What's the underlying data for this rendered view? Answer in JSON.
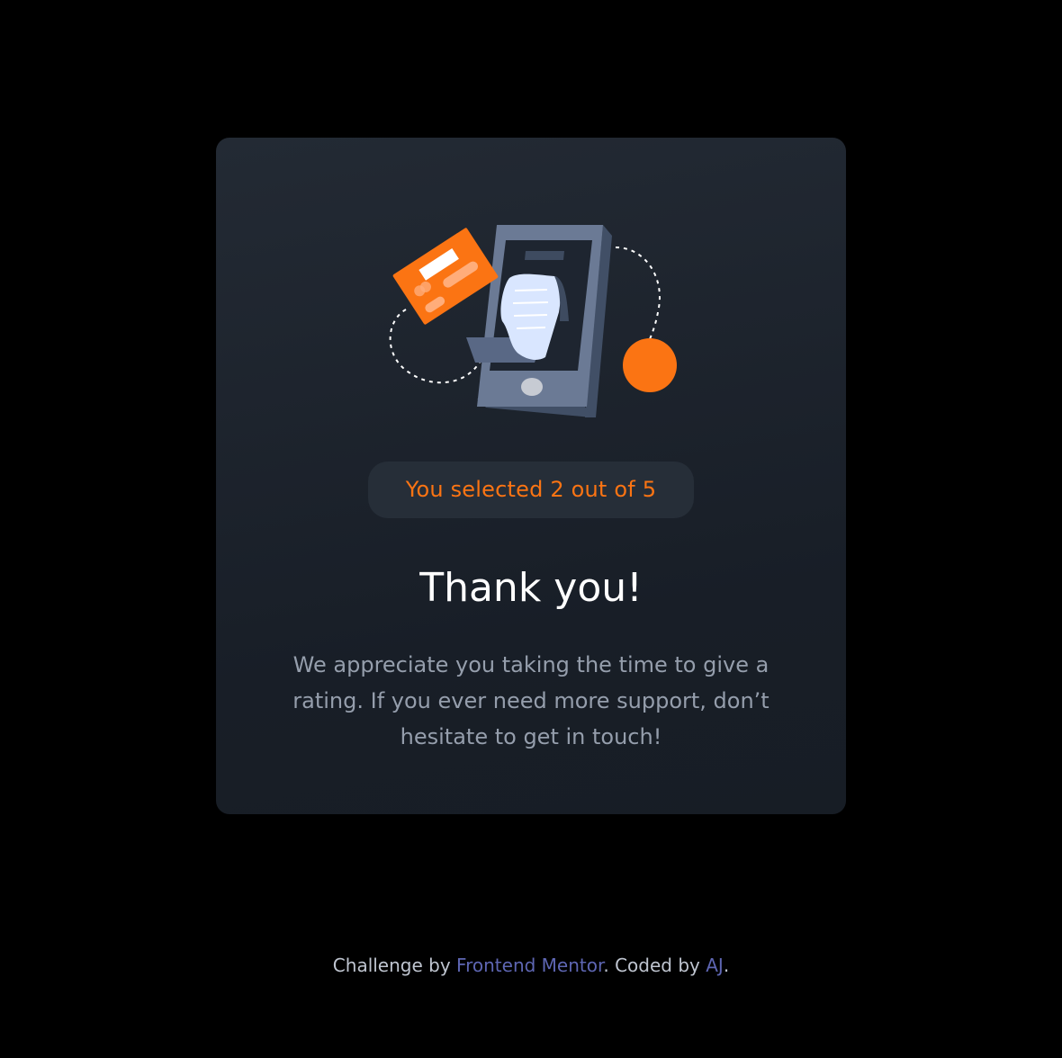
{
  "card": {
    "selection_text": "You selected 2 out of 5",
    "title": "Thank you!",
    "message": "We appreciate you taking the time to give a rating. If you ever need more support, don’t hesitate to get in touch!",
    "illustration_icon": "thank-you-phone-receipt-card-illustration"
  },
  "footer": {
    "prefix": "Challenge by ",
    "link1": "Frontend Mentor",
    "middle": ". Coded by ",
    "link2": "AJ",
    "suffix": "."
  },
  "colors": {
    "background": "#000000",
    "card": "#1e2530",
    "accent": "#fb7413",
    "title": "#ffffff",
    "muted": "#959eac",
    "link": "#5e66b3"
  }
}
